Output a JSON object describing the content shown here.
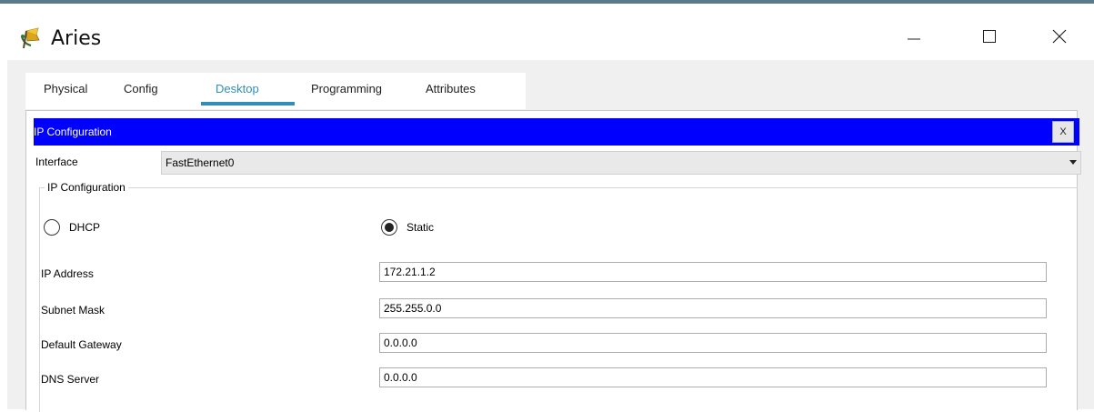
{
  "window": {
    "title": "Aries",
    "icon": "antenna-flag-icon",
    "controls": {
      "minimize": "minimize-icon",
      "maximize": "maximize-icon",
      "close": "close-icon"
    }
  },
  "tabs": [
    {
      "label": "Physical"
    },
    {
      "label": "Config"
    },
    {
      "label": "Desktop"
    },
    {
      "label": "Programming"
    },
    {
      "label": "Attributes"
    }
  ],
  "active_tab": "Desktop",
  "ip_config": {
    "header_title": "IP Configuration",
    "close_label": "X",
    "interface_label": "Interface",
    "interface_value": "FastEthernet0",
    "group_legend": "IP Configuration",
    "dhcp_label": "DHCP",
    "static_label": "Static",
    "mode": "Static",
    "fields": {
      "ip_address": {
        "label": "IP Address",
        "value": "172.21.1.2"
      },
      "subnet_mask": {
        "label": "Subnet Mask",
        "value": "255.255.0.0"
      },
      "default_gateway": {
        "label": "Default Gateway",
        "value": "0.0.0.0"
      },
      "dns_server": {
        "label": "DNS Server",
        "value": "0.0.0.0"
      }
    }
  },
  "colors": {
    "header_bg": "#0000ff",
    "active_tab": "#2f8fb8",
    "content_bg": "#f0f0f0"
  }
}
